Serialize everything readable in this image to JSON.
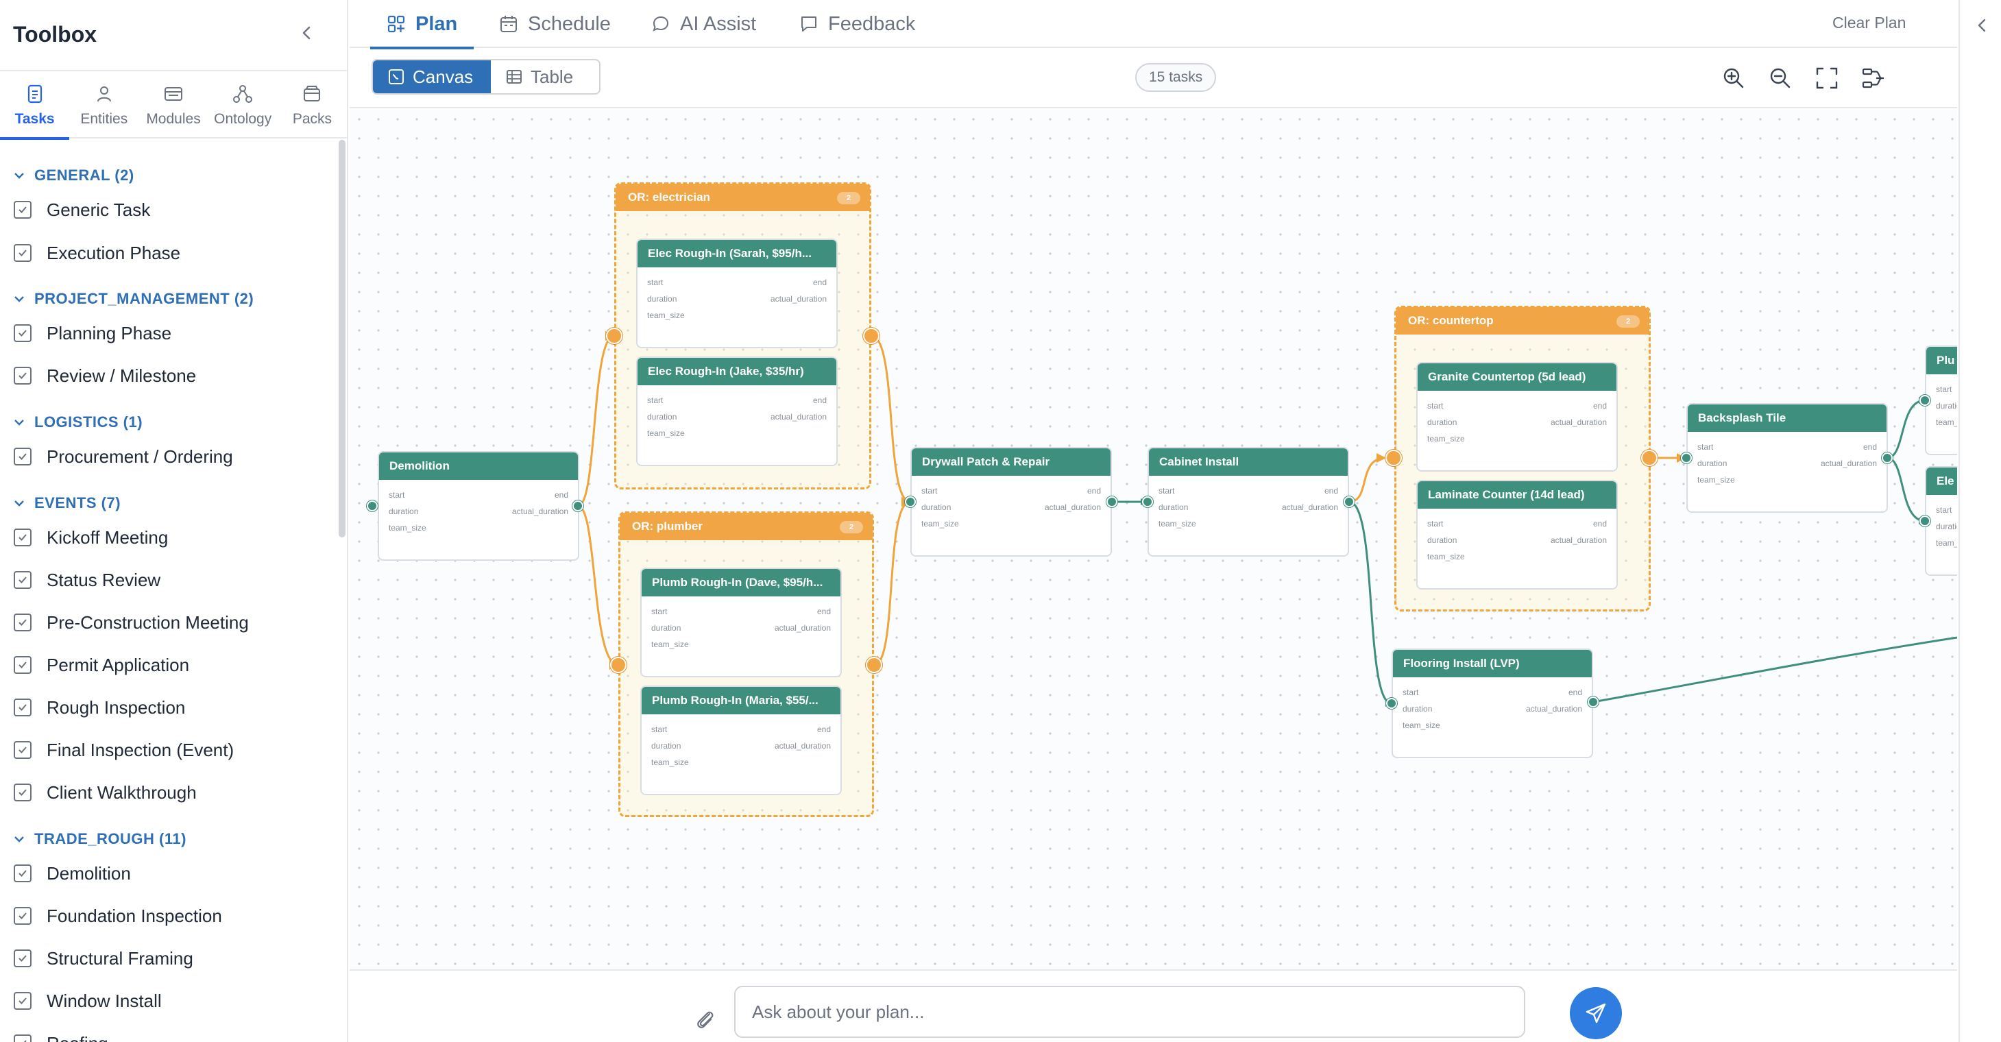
{
  "sidebar": {
    "title": "Toolbox",
    "tabs": [
      {
        "label": "Tasks",
        "icon": "document-icon",
        "active": true
      },
      {
        "label": "Entities",
        "icon": "person-icon",
        "active": false
      },
      {
        "label": "Modules",
        "icon": "modules-icon",
        "active": false
      },
      {
        "label": "Ontology",
        "icon": "ontology-icon",
        "active": false
      },
      {
        "label": "Packs",
        "icon": "package-icon",
        "active": false
      }
    ],
    "groups": [
      {
        "title": "GENERAL (2)",
        "items": [
          "Generic Task",
          "Execution Phase"
        ]
      },
      {
        "title": "PROJECT_MANAGEMENT (2)",
        "items": [
          "Planning Phase",
          "Review / Milestone"
        ]
      },
      {
        "title": "LOGISTICS (1)",
        "items": [
          "Procurement / Ordering"
        ]
      },
      {
        "title": "EVENTS (7)",
        "items": [
          "Kickoff Meeting",
          "Status Review",
          "Pre-Construction Meeting",
          "Permit Application",
          "Rough Inspection",
          "Final Inspection (Event)",
          "Client Walkthrough"
        ]
      },
      {
        "title": "TRADE_ROUGH (11)",
        "items": [
          "Demolition",
          "Foundation Inspection",
          "Structural Framing",
          "Window Install",
          "Roofing"
        ]
      }
    ]
  },
  "top_tabs": [
    {
      "label": "Plan",
      "icon": "plan-icon",
      "active": true
    },
    {
      "label": "Schedule",
      "icon": "calendar-icon",
      "active": false
    },
    {
      "label": "AI Assist",
      "icon": "chat-bubble-icon",
      "active": false
    },
    {
      "label": "Feedback",
      "icon": "feedback-icon",
      "active": false
    }
  ],
  "clear_plan": "Clear Plan",
  "view_toggle": {
    "canvas": "Canvas",
    "table": "Table",
    "selected": "Canvas"
  },
  "task_count": "15 tasks",
  "canvas_controls": [
    "zoom-in-icon",
    "zoom-out-icon",
    "fit-view-icon",
    "auto-layout-icon"
  ],
  "field_labels": {
    "start": "start",
    "end": "end",
    "duration": "duration",
    "actual_duration": "actual_duration",
    "team_size": "team_size"
  },
  "or_groups": {
    "electrician": {
      "title": "OR: electrician",
      "count": "2"
    },
    "plumber": {
      "title": "OR: plumber",
      "count": "2"
    },
    "countertop": {
      "title": "OR: countertop",
      "count": "2"
    }
  },
  "nodes": {
    "demolition": "Demolition",
    "elec_sarah": "Elec Rough-In (Sarah, $95/h...",
    "elec_jake": "Elec Rough-In (Jake, $35/hr)",
    "plumb_dave": "Plumb Rough-In (Dave, $95/h...",
    "plumb_maria": "Plumb Rough-In (Maria, $55/...",
    "drywall": "Drywall Patch & Repair",
    "cabinet": "Cabinet Install",
    "granite": "Granite Countertop (5d lead)",
    "laminate": "Laminate Counter (14d lead)",
    "backsplash": "Backsplash Tile",
    "flooring": "Flooring Install (LVP)",
    "plumbing_cut": "Plu",
    "electrical_cut": "Ele"
  },
  "chat": {
    "placeholder": "Ask about your plan..."
  },
  "colors": {
    "accent": "#2e6fb5",
    "node_header": "#3f8f7e",
    "or_group": "#f2a545",
    "send_button": "#2f7de0"
  }
}
